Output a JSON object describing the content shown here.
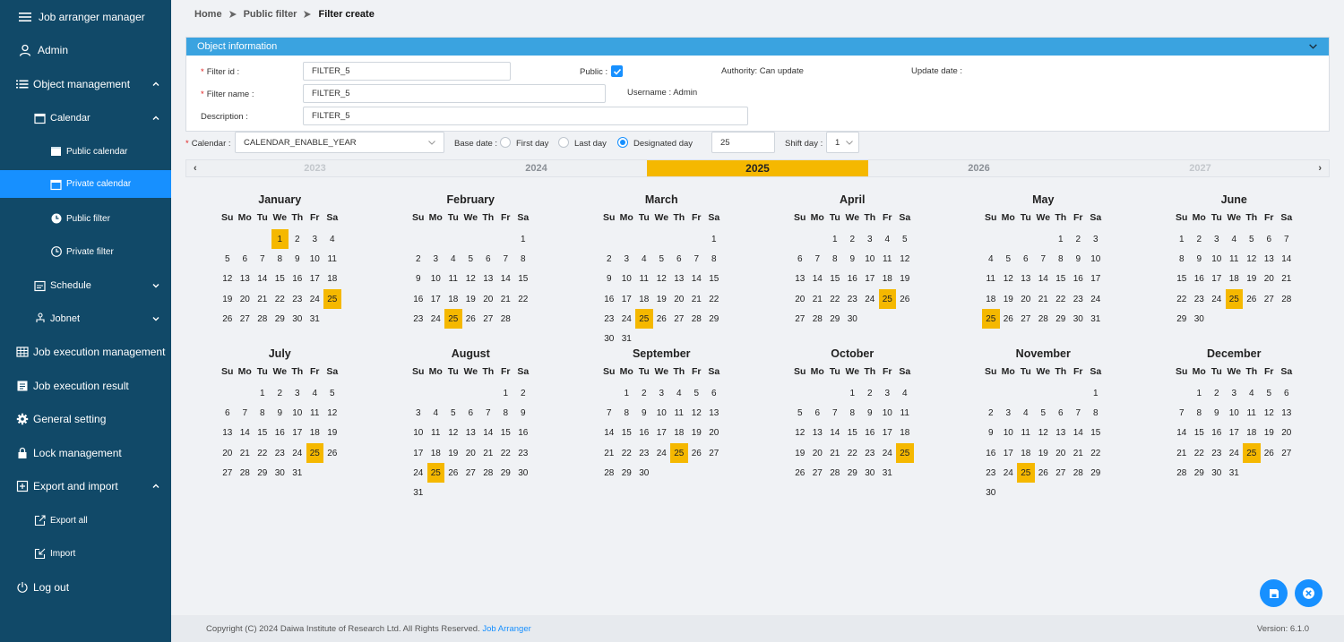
{
  "app": {
    "title": "Job arranger manager",
    "user": "Admin"
  },
  "sidebar": {
    "object_management": "Object management",
    "calendar": "Calendar",
    "public_calendar": "Public calendar",
    "private_calendar": "Private calendar",
    "public_filter": "Public filter",
    "private_filter": "Private filter",
    "schedule": "Schedule",
    "jobnet": "Jobnet",
    "job_execution_management": "Job execution management",
    "job_execution_result": "Job execution result",
    "general_setting": "General setting",
    "lock_management": "Lock management",
    "export_and_import": "Export and import",
    "export_all": "Export all",
    "import": "Import",
    "log_out": "Log out"
  },
  "breadcrumb": {
    "home": "Home",
    "parent": "Public filter",
    "current": "Filter create"
  },
  "object_info": {
    "header": "Object information",
    "filter_id_label": "Filter id :",
    "filter_id": "FILTER_5",
    "filter_name_label": "Filter name :",
    "filter_name": "FILTER_5",
    "description_label": "Description :",
    "description": "FILTER_5",
    "public_label": "Public :",
    "public_checked": true,
    "authority": "Authority: Can update",
    "update_date_label": "Update date :",
    "username": "Username : Admin"
  },
  "calendar_row": {
    "calendar_label": "Calendar :",
    "calendar_value": "CALENDAR_ENABLE_YEAR",
    "base_date_label": "Base date :",
    "first_day": "First day",
    "last_day": "Last day",
    "designated_day": "Designated day",
    "selected_base": "Designated day",
    "designated_value": "25",
    "shift_day_label": "Shift day :",
    "shift_day_value": "1"
  },
  "years": [
    "2023",
    "2024",
    "2025",
    "2026",
    "2027"
  ],
  "selected_year": "2025",
  "arrows": {
    "prev": "‹",
    "next": "›"
  },
  "dow": [
    "Su",
    "Mo",
    "Tu",
    "We",
    "Th",
    "Fr",
    "Sa"
  ],
  "months": [
    {
      "name": "January",
      "start": 3,
      "days": 31,
      "highlight": [
        1,
        25
      ]
    },
    {
      "name": "February",
      "start": 6,
      "days": 28,
      "highlight": [
        25
      ]
    },
    {
      "name": "March",
      "start": 6,
      "days": 31,
      "highlight": [
        25
      ]
    },
    {
      "name": "April",
      "start": 2,
      "days": 30,
      "highlight": [
        25
      ]
    },
    {
      "name": "May",
      "start": 4,
      "days": 31,
      "highlight": [
        25
      ]
    },
    {
      "name": "June",
      "start": 0,
      "days": 30,
      "highlight": [
        25
      ]
    },
    {
      "name": "July",
      "start": 2,
      "days": 31,
      "highlight": [
        25
      ]
    },
    {
      "name": "August",
      "start": 5,
      "days": 31,
      "highlight": [
        25
      ]
    },
    {
      "name": "September",
      "start": 1,
      "days": 30,
      "highlight": [
        25
      ]
    },
    {
      "name": "October",
      "start": 3,
      "days": 31,
      "highlight": [
        25
      ]
    },
    {
      "name": "November",
      "start": 6,
      "days": 30,
      "highlight": [
        25
      ]
    },
    {
      "name": "December",
      "start": 1,
      "days": 31,
      "highlight": [
        25
      ]
    }
  ],
  "footer": {
    "copyright": "Copyright (C) 2024 Daiwa Institute of Research Ltd. All Rights Reserved.",
    "link": "Job Arranger",
    "version": "Version: 6.1.0"
  },
  "colors": {
    "sidebar": "#114968",
    "active": "#1790ff",
    "highlight": "#f5b800",
    "header": "#3aa3e0"
  }
}
